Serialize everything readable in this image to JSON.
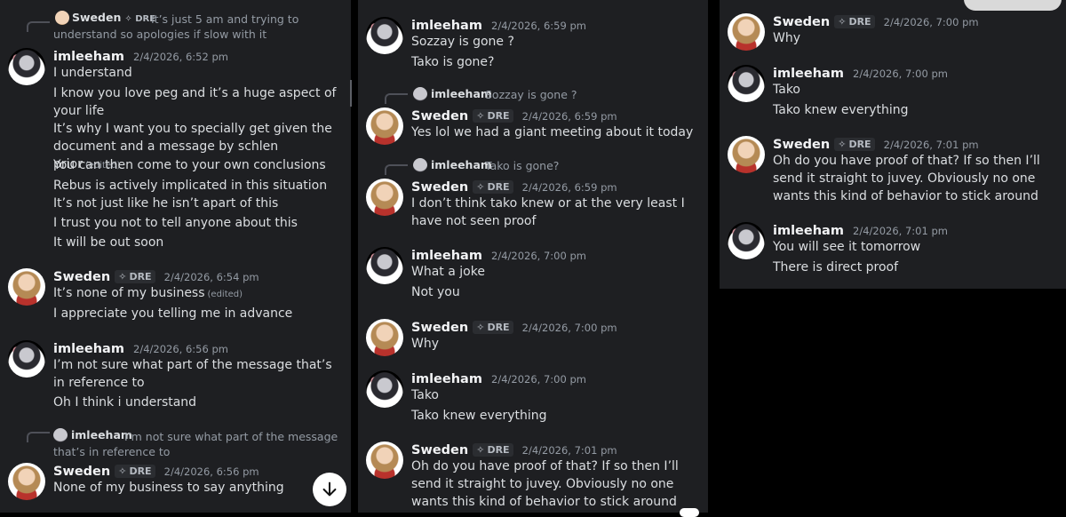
{
  "users": {
    "sweden": {
      "name": "Sweden",
      "tag": "DRE",
      "tag_icon": "✧"
    },
    "imleeham": {
      "name": "imleeham"
    }
  },
  "edited_label": "(edited)",
  "panel1": {
    "reply1": {
      "name": "Sweden",
      "tag": "DRE",
      "text": "It’s just 5 am and trying to understand so apologies if slow with it"
    },
    "msg1": {
      "time": "2/4/2026, 6:52 pm",
      "lines": [
        "I understand",
        "I know you love peg and it’s a huge aspect of your life",
        "It’s why I want you to specially get given the document and a message by schlen prior",
        "You can then come to your own conclusions",
        "Rebus is actively implicated in this situation",
        "It’s not just like he isn’t apart of this",
        "I trust you not to tell anyone about this",
        "It will be out soon"
      ]
    },
    "msg2": {
      "time": "2/4/2026, 6:54 pm",
      "lines": [
        "It’s none of my business",
        "I appreciate you telling me in advance"
      ]
    },
    "msg3": {
      "time": "2/4/2026, 6:56 pm",
      "lines": [
        "I’m not sure what part of the message that’s in reference to",
        "Oh I think i understand"
      ]
    },
    "reply2": {
      "name": "imleeham",
      "text": "I’m not sure what part of the message that’s in reference to"
    },
    "msg4": {
      "time": "2/4/2026, 6:56 pm",
      "lines": [
        "None of my business to say anything"
      ]
    }
  },
  "panel2": {
    "msg1": {
      "time": "2/4/2026, 6:59 pm",
      "lines": [
        "Sozzay is gone ?",
        "Tako is gone?"
      ]
    },
    "reply1": {
      "name": "imleeham",
      "text": "Sozzay is gone ?"
    },
    "msg2": {
      "time": "2/4/2026, 6:59 pm",
      "lines": [
        "Yes lol we had a giant meeting about it today"
      ]
    },
    "reply2": {
      "name": "imleeham",
      "text": "Tako is gone?"
    },
    "msg3": {
      "time": "2/4/2026, 6:59 pm",
      "lines": [
        "I don’t think tako knew or at the very least I have not seen proof"
      ]
    },
    "msg4": {
      "time": "2/4/2026, 7:00 pm",
      "lines": [
        "What a joke",
        "Not you"
      ]
    },
    "msg5": {
      "time": "2/4/2026, 7:00 pm",
      "lines": [
        "Why"
      ]
    },
    "msg6": {
      "time": "2/4/2026, 7:00 pm",
      "lines": [
        "Tako",
        "Tako knew everything"
      ]
    },
    "msg7": {
      "time": "2/4/2026, 7:01 pm",
      "lines": [
        "Oh do you have proof of that? If so then I’ll send it straight to juvey. Obviously no one wants this kind of behavior to stick around"
      ]
    }
  },
  "panel3": {
    "msg1": {
      "time": "2/4/2026, 7:00 pm",
      "lines": [
        "Why"
      ]
    },
    "msg2": {
      "time": "2/4/2026, 7:00 pm",
      "lines": [
        "Tako",
        "Tako knew everything"
      ]
    },
    "msg3": {
      "time": "2/4/2026, 7:01 pm",
      "lines": [
        "Oh do you have proof of that? If so then I’ll send it straight to juvey. Obviously no one wants this kind of behavior to stick around"
      ]
    },
    "msg4": {
      "time": "2/4/2026, 7:01 pm",
      "lines": [
        "You will see it tomorrow",
        "There is direct proof"
      ]
    }
  },
  "icons": {
    "scroll_down": "arrow-down-icon",
    "tag": "sparkle-icon"
  },
  "colors": {
    "background": "#1e1f22",
    "text": "#dbdee1",
    "muted": "#949ba4",
    "name": "#f2f3f5"
  }
}
